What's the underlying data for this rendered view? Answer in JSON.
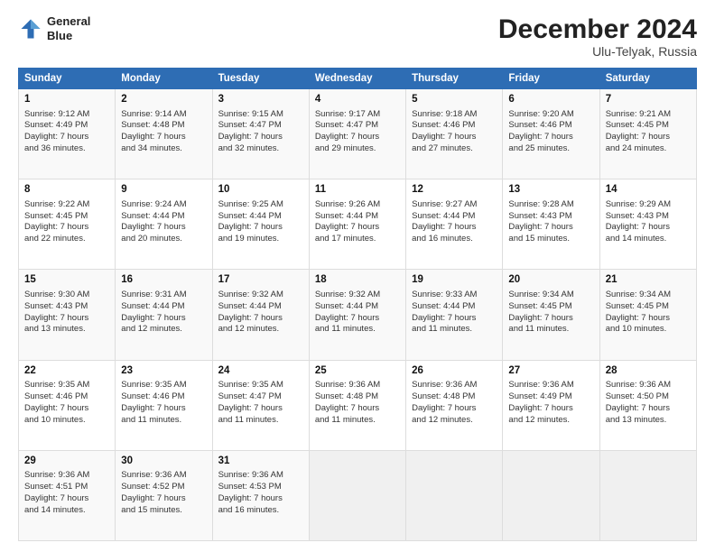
{
  "header": {
    "logo_line1": "General",
    "logo_line2": "Blue",
    "month": "December 2024",
    "location": "Ulu-Telyak, Russia"
  },
  "weekdays": [
    "Sunday",
    "Monday",
    "Tuesday",
    "Wednesday",
    "Thursday",
    "Friday",
    "Saturday"
  ],
  "weeks": [
    [
      {
        "day": "1",
        "lines": [
          "Sunrise: 9:12 AM",
          "Sunset: 4:49 PM",
          "Daylight: 7 hours",
          "and 36 minutes."
        ]
      },
      {
        "day": "2",
        "lines": [
          "Sunrise: 9:14 AM",
          "Sunset: 4:48 PM",
          "Daylight: 7 hours",
          "and 34 minutes."
        ]
      },
      {
        "day": "3",
        "lines": [
          "Sunrise: 9:15 AM",
          "Sunset: 4:47 PM",
          "Daylight: 7 hours",
          "and 32 minutes."
        ]
      },
      {
        "day": "4",
        "lines": [
          "Sunrise: 9:17 AM",
          "Sunset: 4:47 PM",
          "Daylight: 7 hours",
          "and 29 minutes."
        ]
      },
      {
        "day": "5",
        "lines": [
          "Sunrise: 9:18 AM",
          "Sunset: 4:46 PM",
          "Daylight: 7 hours",
          "and 27 minutes."
        ]
      },
      {
        "day": "6",
        "lines": [
          "Sunrise: 9:20 AM",
          "Sunset: 4:46 PM",
          "Daylight: 7 hours",
          "and 25 minutes."
        ]
      },
      {
        "day": "7",
        "lines": [
          "Sunrise: 9:21 AM",
          "Sunset: 4:45 PM",
          "Daylight: 7 hours",
          "and 24 minutes."
        ]
      }
    ],
    [
      {
        "day": "8",
        "lines": [
          "Sunrise: 9:22 AM",
          "Sunset: 4:45 PM",
          "Daylight: 7 hours",
          "and 22 minutes."
        ]
      },
      {
        "day": "9",
        "lines": [
          "Sunrise: 9:24 AM",
          "Sunset: 4:44 PM",
          "Daylight: 7 hours",
          "and 20 minutes."
        ]
      },
      {
        "day": "10",
        "lines": [
          "Sunrise: 9:25 AM",
          "Sunset: 4:44 PM",
          "Daylight: 7 hours",
          "and 19 minutes."
        ]
      },
      {
        "day": "11",
        "lines": [
          "Sunrise: 9:26 AM",
          "Sunset: 4:44 PM",
          "Daylight: 7 hours",
          "and 17 minutes."
        ]
      },
      {
        "day": "12",
        "lines": [
          "Sunrise: 9:27 AM",
          "Sunset: 4:44 PM",
          "Daylight: 7 hours",
          "and 16 minutes."
        ]
      },
      {
        "day": "13",
        "lines": [
          "Sunrise: 9:28 AM",
          "Sunset: 4:43 PM",
          "Daylight: 7 hours",
          "and 15 minutes."
        ]
      },
      {
        "day": "14",
        "lines": [
          "Sunrise: 9:29 AM",
          "Sunset: 4:43 PM",
          "Daylight: 7 hours",
          "and 14 minutes."
        ]
      }
    ],
    [
      {
        "day": "15",
        "lines": [
          "Sunrise: 9:30 AM",
          "Sunset: 4:43 PM",
          "Daylight: 7 hours",
          "and 13 minutes."
        ]
      },
      {
        "day": "16",
        "lines": [
          "Sunrise: 9:31 AM",
          "Sunset: 4:44 PM",
          "Daylight: 7 hours",
          "and 12 minutes."
        ]
      },
      {
        "day": "17",
        "lines": [
          "Sunrise: 9:32 AM",
          "Sunset: 4:44 PM",
          "Daylight: 7 hours",
          "and 12 minutes."
        ]
      },
      {
        "day": "18",
        "lines": [
          "Sunrise: 9:32 AM",
          "Sunset: 4:44 PM",
          "Daylight: 7 hours",
          "and 11 minutes."
        ]
      },
      {
        "day": "19",
        "lines": [
          "Sunrise: 9:33 AM",
          "Sunset: 4:44 PM",
          "Daylight: 7 hours",
          "and 11 minutes."
        ]
      },
      {
        "day": "20",
        "lines": [
          "Sunrise: 9:34 AM",
          "Sunset: 4:45 PM",
          "Daylight: 7 hours",
          "and 11 minutes."
        ]
      },
      {
        "day": "21",
        "lines": [
          "Sunrise: 9:34 AM",
          "Sunset: 4:45 PM",
          "Daylight: 7 hours",
          "and 10 minutes."
        ]
      }
    ],
    [
      {
        "day": "22",
        "lines": [
          "Sunrise: 9:35 AM",
          "Sunset: 4:46 PM",
          "Daylight: 7 hours",
          "and 10 minutes."
        ]
      },
      {
        "day": "23",
        "lines": [
          "Sunrise: 9:35 AM",
          "Sunset: 4:46 PM",
          "Daylight: 7 hours",
          "and 11 minutes."
        ]
      },
      {
        "day": "24",
        "lines": [
          "Sunrise: 9:35 AM",
          "Sunset: 4:47 PM",
          "Daylight: 7 hours",
          "and 11 minutes."
        ]
      },
      {
        "day": "25",
        "lines": [
          "Sunrise: 9:36 AM",
          "Sunset: 4:48 PM",
          "Daylight: 7 hours",
          "and 11 minutes."
        ]
      },
      {
        "day": "26",
        "lines": [
          "Sunrise: 9:36 AM",
          "Sunset: 4:48 PM",
          "Daylight: 7 hours",
          "and 12 minutes."
        ]
      },
      {
        "day": "27",
        "lines": [
          "Sunrise: 9:36 AM",
          "Sunset: 4:49 PM",
          "Daylight: 7 hours",
          "and 12 minutes."
        ]
      },
      {
        "day": "28",
        "lines": [
          "Sunrise: 9:36 AM",
          "Sunset: 4:50 PM",
          "Daylight: 7 hours",
          "and 13 minutes."
        ]
      }
    ],
    [
      {
        "day": "29",
        "lines": [
          "Sunrise: 9:36 AM",
          "Sunset: 4:51 PM",
          "Daylight: 7 hours",
          "and 14 minutes."
        ]
      },
      {
        "day": "30",
        "lines": [
          "Sunrise: 9:36 AM",
          "Sunset: 4:52 PM",
          "Daylight: 7 hours",
          "and 15 minutes."
        ]
      },
      {
        "day": "31",
        "lines": [
          "Sunrise: 9:36 AM",
          "Sunset: 4:53 PM",
          "Daylight: 7 hours",
          "and 16 minutes."
        ]
      },
      null,
      null,
      null,
      null
    ]
  ]
}
